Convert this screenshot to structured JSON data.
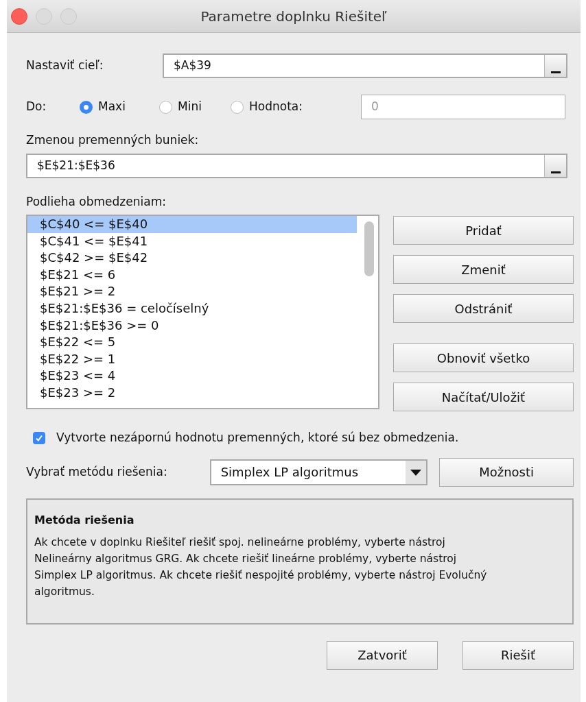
{
  "window": {
    "title": "Parametre doplnku Riešiteľ"
  },
  "objective": {
    "label": "Nastaviť cieľ:",
    "value": "$A$39"
  },
  "to": {
    "label": "Do:",
    "options": [
      {
        "label": "Maxi",
        "selected": true
      },
      {
        "label": "Mini",
        "selected": false
      },
      {
        "label": "Hodnota:",
        "selected": false
      }
    ],
    "value_field": {
      "value": "0",
      "disabled": true
    }
  },
  "variables": {
    "label": "Zmenou premenných buniek:",
    "value": "$E$21:$E$36"
  },
  "constraints": {
    "label": "Podlieha obmedzeniam:",
    "items": [
      {
        "text": "$C$40 <= $E$40",
        "selected": true
      },
      {
        "text": "$C$41 <= $E$41",
        "selected": false
      },
      {
        "text": "$C$42 >= $E$42",
        "selected": false
      },
      {
        "text": "$E$21 <= 6",
        "selected": false
      },
      {
        "text": "$E$21 >= 2",
        "selected": false
      },
      {
        "text": "$E$21:$E$36 = celočíselný",
        "selected": false
      },
      {
        "text": "$E$21:$E$36 >= 0",
        "selected": false
      },
      {
        "text": "$E$22 <= 5",
        "selected": false
      },
      {
        "text": "$E$22 >= 1",
        "selected": false
      },
      {
        "text": "$E$23 <= 4",
        "selected": false
      },
      {
        "text": "$E$23 >= 2",
        "selected": false
      }
    ],
    "buttons": [
      "Pridať",
      "Zmeniť",
      "Odstrániť"
    ],
    "file_buttons": [
      "Obnoviť všetko",
      "Načítať/Uložiť"
    ]
  },
  "nonnegative": {
    "label": "Vytvorte nezápornú hodnotu premenných, ktoré sú bez obmedzenia.",
    "checked": true
  },
  "method": {
    "label": "Vybrať metódu riešenia:",
    "value": "Simplex LP algoritmus",
    "options_button": "Možnosti"
  },
  "description": {
    "title": "Metóda riešenia",
    "text": "Ak chcete v doplnku Riešiteľ riešiť spoj. nelineárne problémy, vyberte nástroj Nelineárny algoritmus GRG. Ak chcete riešiť lineárne problémy, vyberte nástroj Simplex LP algoritmus. Ak chcete riešiť nespojité problémy, vyberte nástroj Evolučný algoritmus."
  },
  "footer_buttons": [
    "Zatvoriť",
    "Riešiť"
  ]
}
